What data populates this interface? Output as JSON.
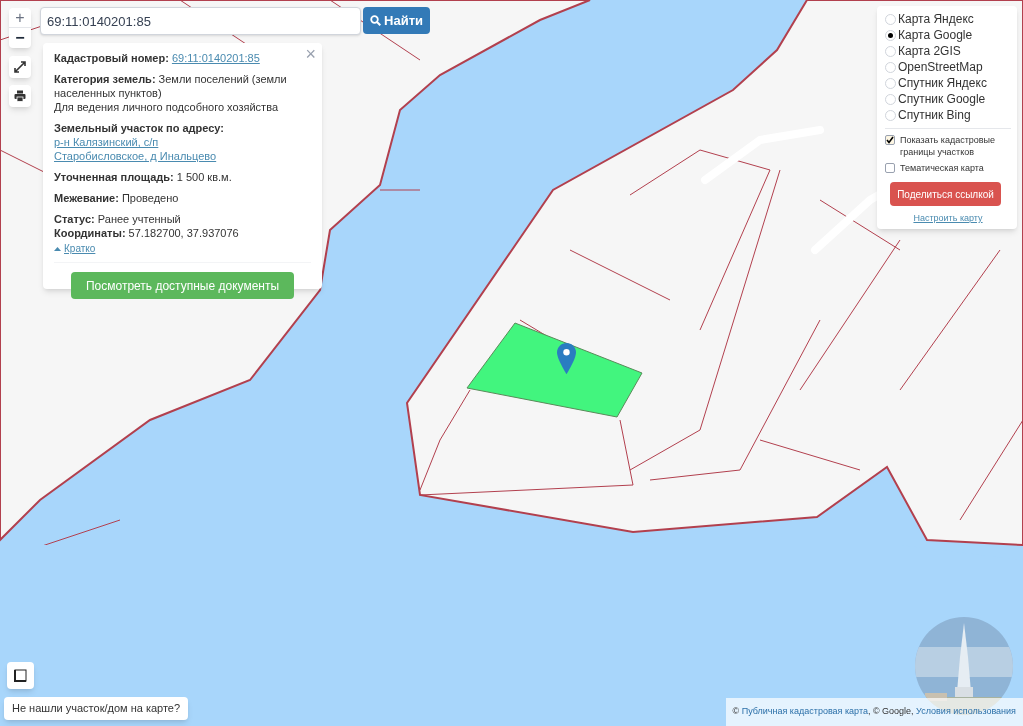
{
  "search": {
    "value": "69:11:0140201:85",
    "button": "Найти"
  },
  "zoom": {
    "in": "+",
    "in_disabled": true,
    "out": "−"
  },
  "popup": {
    "close": "×",
    "sections": [
      [
        {
          "label": "Кадастровый номер:",
          "value": [
            "69:11:0140201:85"
          ],
          "kind": "link"
        }
      ],
      [
        {
          "label": "Категория земель:",
          "value": "Земли поселений (земли населенных пунктов)",
          "kind": "text",
          "note": "Для ведения личного подсобного хозяйства"
        }
      ],
      [
        {
          "label": "Земельный участок по адресу:",
          "value": [
            "р-н Калязинский, с/п",
            "Старобисловское, д Инальцево"
          ],
          "kind": "link"
        }
      ],
      [
        {
          "label": "Уточненная площадь:",
          "value": "1 500 кв.м.",
          "kind": "text"
        }
      ],
      [
        {
          "label": "Межевание:",
          "value": "Проведено",
          "kind": "text"
        }
      ],
      [
        {
          "label": "Статус:",
          "value": "Ранее учтенный",
          "kind": "text"
        },
        {
          "label": "Координаты:",
          "value": "57.182700, 37.937076",
          "kind": "text"
        }
      ]
    ],
    "toggle": "Кратко",
    "button": "Посмотреть доступные документы"
  },
  "layers": {
    "maps": [
      {
        "label": "Карта Яндекс",
        "selected": false
      },
      {
        "label": "Карта Google",
        "selected": true
      },
      {
        "label": "Карта 2GIS",
        "selected": false
      },
      {
        "label": "OpenStreetMap",
        "selected": false
      },
      {
        "label": "Спутник Яндекс",
        "selected": false
      },
      {
        "label": "Спутник Google",
        "selected": false
      },
      {
        "label": "Спутник Bing",
        "selected": false
      }
    ],
    "options": [
      {
        "label": "Показать кадастровые границы участков",
        "checked": true
      },
      {
        "label": "Тематическая карта",
        "checked": false
      }
    ],
    "share": "Поделиться ссылкой",
    "settings": "Настроить карту"
  },
  "help_button": "Не нашли участок/дом на карте?",
  "attribution": [
    {
      "text": "© ",
      "kind": "text"
    },
    {
      "text": "Публичная кадастровая карта",
      "kind": "link"
    },
    {
      "text": ", © Google, ",
      "kind": "text"
    },
    {
      "text": "Условия использования",
      "kind": "link"
    }
  ]
}
